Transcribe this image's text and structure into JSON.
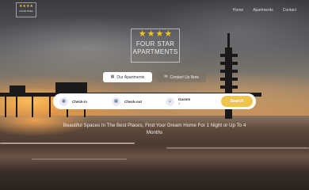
{
  "header": {
    "logo": {
      "stars": "★★★★",
      "text": "FOUR STAR"
    },
    "nav": [
      "Home",
      "Apartments",
      "Contact"
    ]
  },
  "brand": {
    "stars": [
      "★",
      "★",
      "★",
      "★"
    ],
    "name_line1": "FOUR STAR",
    "name_line2": "APARTMENTS"
  },
  "actions": {
    "our_apartments": "Our Apartments",
    "contact_us": "Contact Us Now"
  },
  "booking": {
    "checkin_label": "Check-in",
    "checkout_label": "Check-out",
    "guests_label": "Guests",
    "guests_value": "1",
    "search_label": "Search"
  },
  "tagline": "Beautiful Spaces In The Best Places, Find Your Dream Home For 1 Night or Up To 4 Months",
  "colors": {
    "accent": "#f0c54e",
    "stars": "#f5c518"
  }
}
